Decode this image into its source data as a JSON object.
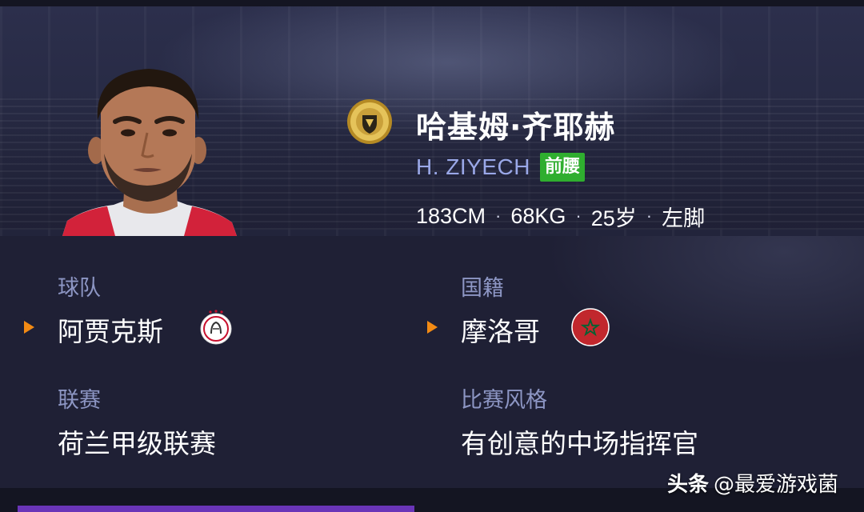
{
  "player": {
    "name_cn": "哈基姆·齐耶赫",
    "name_en": "H. ZIYECH",
    "position_tag": "前腰",
    "height": "183CM",
    "weight": "68KG",
    "age": "25岁",
    "foot": "左脚",
    "stat_separator": "·"
  },
  "info": {
    "team_label": "球队",
    "team_value": "阿贾克斯",
    "nationality_label": "国籍",
    "nationality_value": "摩洛哥",
    "league_label": "联赛",
    "league_value": "荷兰甲级联赛",
    "style_label": "比赛风格",
    "style_value": "有创意的中场指挥官"
  },
  "watermark": {
    "app": "头条",
    "handle": "@最爱游戏菌"
  },
  "colors": {
    "background": "#1f2035",
    "label": "#8d96c4",
    "name_en": "#9aa8e8",
    "position_tag": "#2fae2f",
    "arrow": "#f28a14",
    "accent_bar": "#6a35b8"
  },
  "icons": {
    "badge": "gold-coin-badge-icon",
    "team_arrow": "play-arrow-icon",
    "team_emblem": "ajax-crest-icon",
    "nation_arrow": "play-arrow-icon",
    "nation_flag": "morocco-flag-icon"
  }
}
